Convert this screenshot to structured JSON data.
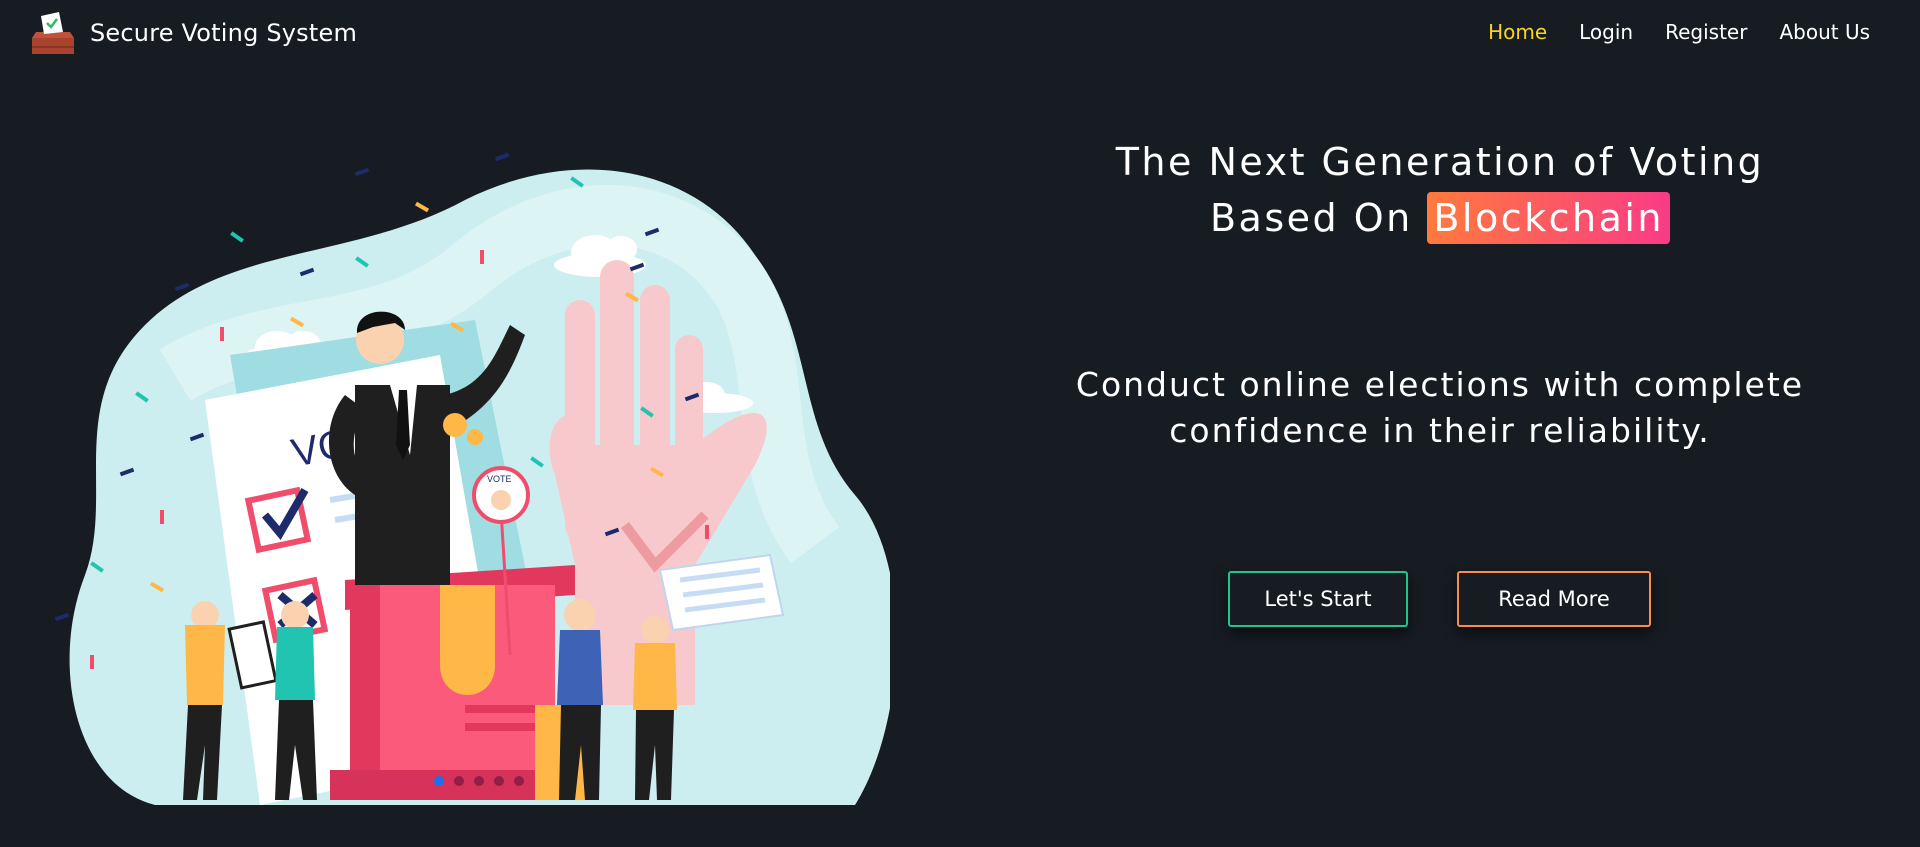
{
  "navbar": {
    "brand": "Secure Voting System",
    "logo_icon": "ballot-box-icon",
    "links": [
      {
        "label": "Home",
        "active": true
      },
      {
        "label": "Login",
        "active": false
      },
      {
        "label": "Register",
        "active": false
      },
      {
        "label": "About Us",
        "active": false
      }
    ]
  },
  "illustration": {
    "ballot_text": "VOTE",
    "badge_text": "VOTE"
  },
  "hero": {
    "title_line1": "The Next Generation of Voting",
    "title_line2_prefix": "Based On",
    "title_highlight": "Blockchain",
    "subtitle_line1": "Conduct online elections with complete",
    "subtitle_line2": "confidence in their reliability."
  },
  "buttons": {
    "start": "Let's Start",
    "read_more": "Read More"
  },
  "carousel": {
    "count": 5,
    "active_index": 0
  },
  "colors": {
    "background": "#161c22",
    "nav_active": "#f6d51f",
    "highlight_start": "#ff7a3d",
    "highlight_end": "#f93b86",
    "start_border": "#22c48a",
    "read_border": "#ff8a4c"
  }
}
